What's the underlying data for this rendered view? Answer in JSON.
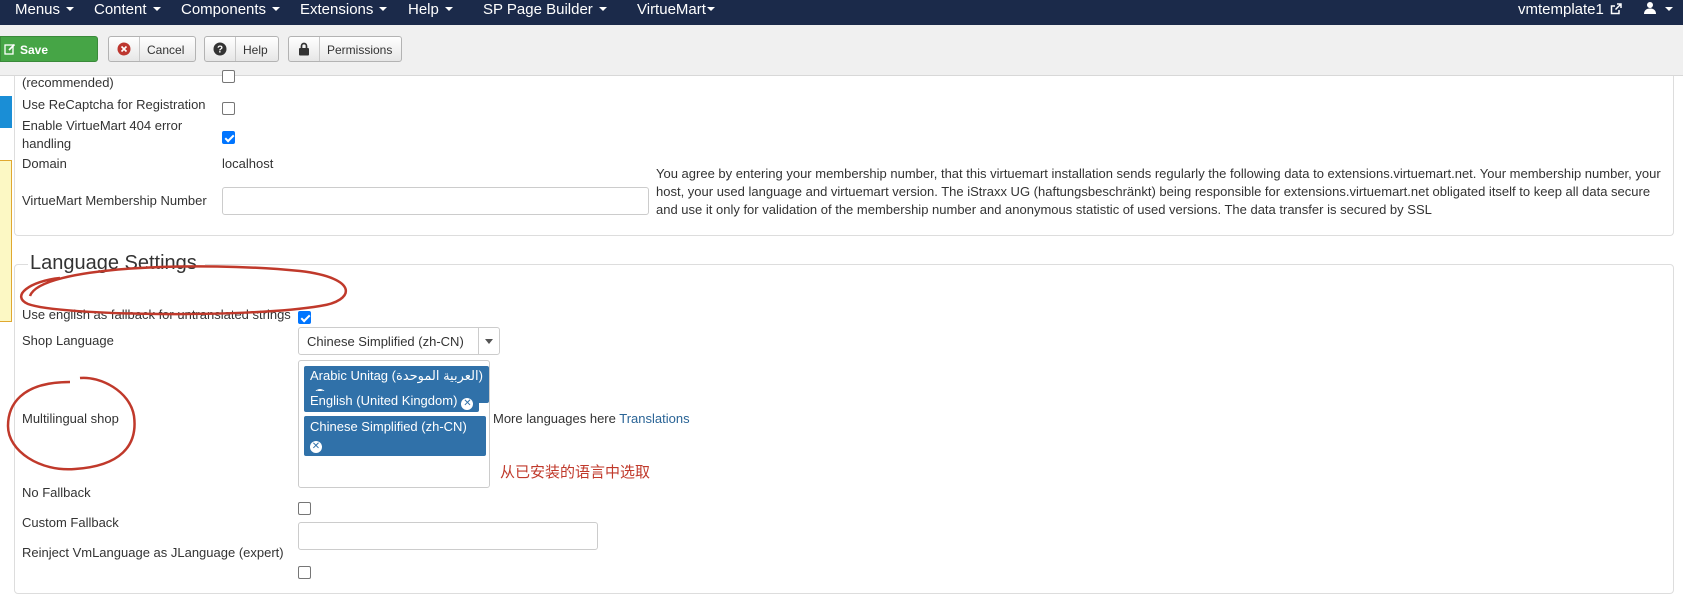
{
  "nav": {
    "menus": [
      "Menus",
      "Content",
      "Components",
      "Extensions",
      "Help",
      "SP Page Builder",
      "VirtueMart"
    ],
    "site_name": "vmtemplate1",
    "external_link_icon": "external-link-icon",
    "user_icon": "user-icon"
  },
  "toolbar": {
    "save": "Save",
    "cancel": "Cancel",
    "help": "Help",
    "permissions": "Permissions",
    "save_color": "#46a546"
  },
  "shop_settings": {
    "recommended_label": "(recommended)",
    "recaptcha_label": "Use ReCaptcha for Registration",
    "error404_label_line1": "Enable VirtueMart 404 error",
    "error404_label_line2": "handling",
    "domain_label": "Domain",
    "domain_value": "localhost",
    "membership_label": "VirtueMart Membership Number",
    "membership_value": "",
    "membership_help": "You agree by entering your membership number, that this virtuemart installation sends regularly the following data to extensions.virtuemart.net. Your membership number, your host, your used language and virtuemart version. The iStraxx UG (haftungsbeschränkt) being responsible for extensions.virtuemart.net obligated itself to keep all data secure and use it only for validation of the membership number and anonymous statistic of used versions. The data transfer is secured by SSL",
    "recommended_checked": false,
    "recaptcha_checked": false,
    "error404_checked": true
  },
  "language_settings": {
    "title": "Language Settings",
    "fallback_label": "Use english as fallback for untranslated strings",
    "fallback_checked": true,
    "shop_language_label": "Shop Language",
    "shop_language_value": "Chinese Simplified (zh-CN)",
    "multilingual_label": "Multilingual shop",
    "languages": [
      "Arabic Unitag (العربية الموحدة)",
      "English (United Kingdom)",
      "Chinese Simplified (zh-CN)"
    ],
    "more_languages_text": "More languages here",
    "translations_link": "Translations",
    "annotation_zh": "从已安装的语言中选取",
    "no_fallback_label": "No Fallback",
    "no_fallback_checked": false,
    "custom_fallback_label": "Custom Fallback",
    "custom_fallback_value": "",
    "reinject_label": "Reinject VmLanguage as JLanguage (expert)",
    "reinject_checked": false
  },
  "annotation_color": "#c0392b",
  "tag_color": "#3071a9"
}
